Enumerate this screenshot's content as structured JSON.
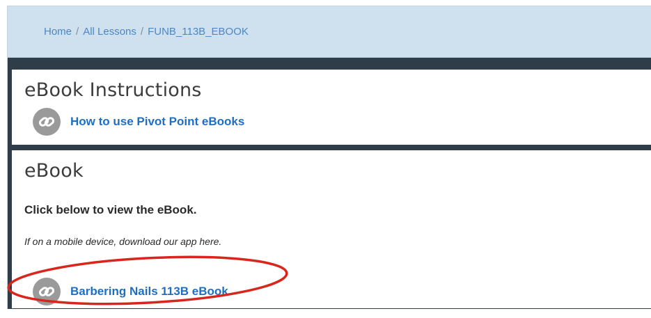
{
  "breadcrumb": {
    "home": "Home",
    "separator": "/",
    "all_lessons": "All Lessons",
    "current": "FUNB_113B_EBOOK"
  },
  "instructions_card": {
    "title": "eBook Instructions",
    "link_label": "How to use Pivot Point eBooks",
    "link_icon": "link-icon"
  },
  "ebook_card": {
    "title": "eBook",
    "line1": "Click below to view the eBook.",
    "line2": "If on a mobile device, download our app here.",
    "link_label": "Barbering Nails 113B eBook",
    "link_icon": "link-icon"
  },
  "colors": {
    "link": "#1e6fc4",
    "breadcrumb_bg": "#cfe0ef",
    "frame": "#2f3d49",
    "highlight": "#d9261c"
  }
}
